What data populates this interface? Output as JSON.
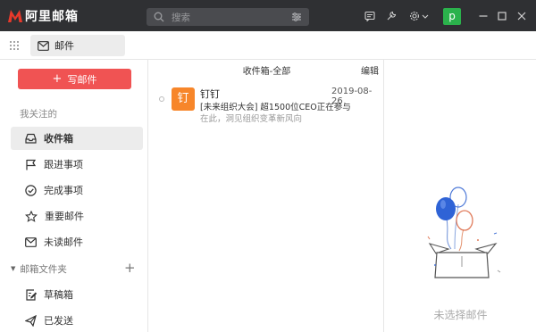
{
  "app": {
    "title": "阿里邮箱",
    "brand_color": "#e8392b"
  },
  "search": {
    "placeholder": "搜索"
  },
  "titlebar": {
    "icons": [
      "compose-note-icon",
      "tools-icon",
      "settings-icon",
      "minimize-icon",
      "maximize-icon",
      "close-icon"
    ],
    "avatar_letter": "p",
    "avatar_color": "#2bb24c"
  },
  "toolbar": {
    "mail_tab_label": "邮件"
  },
  "sidebar": {
    "compose_label": "写邮件",
    "compose_color": "#f05353",
    "section_title": "我关注的",
    "items": [
      {
        "label": "收件箱",
        "icon": "inbox-icon",
        "active": true
      },
      {
        "label": "跟进事项",
        "icon": "flag-icon",
        "active": false
      },
      {
        "label": "完成事项",
        "icon": "check-circle-icon",
        "active": false
      },
      {
        "label": "重要邮件",
        "icon": "star-icon",
        "active": false
      },
      {
        "label": "未读邮件",
        "icon": "envelope-icon",
        "active": false
      }
    ],
    "folders_title": "邮箱文件夹",
    "folders": [
      {
        "label": "草稿箱",
        "icon": "draft-icon"
      },
      {
        "label": "已发送",
        "icon": "sent-icon"
      }
    ]
  },
  "mail_list": {
    "title": "收件箱-全部",
    "edit_label": "编辑",
    "items": [
      {
        "avatar": "钉",
        "sender": "钉钉",
        "date": "2019-08-26",
        "subject": "[未来组织大会] 超1500位CEO正在参与",
        "preview": "在此，洞见组织变革新风向"
      }
    ]
  },
  "preview_pane": {
    "empty_text": "未选择邮件"
  }
}
